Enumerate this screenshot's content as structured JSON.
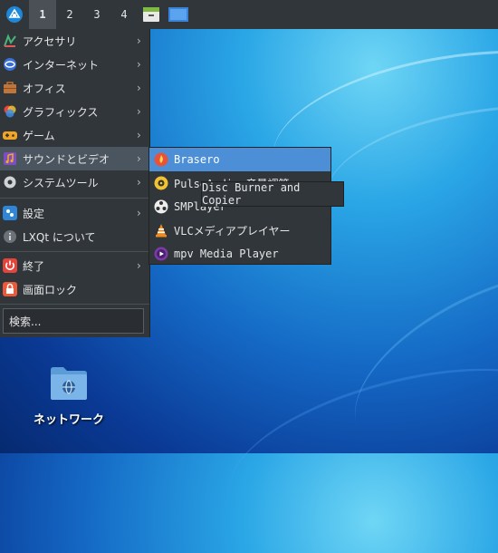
{
  "panel": {
    "desktops": [
      "1",
      "2",
      "3",
      "4"
    ],
    "active_desktop": "1"
  },
  "menu": {
    "items": [
      {
        "label": "アクセサリ",
        "icon": "accessories-icon"
      },
      {
        "label": "インターネット",
        "icon": "internet-icon"
      },
      {
        "label": "オフィス",
        "icon": "office-icon"
      },
      {
        "label": "グラフィックス",
        "icon": "graphics-icon"
      },
      {
        "label": "ゲーム",
        "icon": "games-icon"
      },
      {
        "label": "サウンドとビデオ",
        "icon": "sound-video-icon"
      },
      {
        "label": "システムツール",
        "icon": "system-tools-icon"
      }
    ],
    "settings": "設定",
    "about": "LXQt について",
    "shutdown": "終了",
    "lock": "画面ロック",
    "search_placeholder": "検索..."
  },
  "submenu": {
    "items": [
      {
        "label": "Brasero",
        "icon": "brasero-icon"
      },
      {
        "label": "PulseAudio 音量調節",
        "icon": "pulseaudio-icon"
      },
      {
        "label": "SMPlayer",
        "icon": "smplayer-icon"
      },
      {
        "label": "VLCメディアプレイヤー",
        "icon": "vlc-icon"
      },
      {
        "label": "mpv Media Player",
        "icon": "mpv-icon"
      }
    ]
  },
  "tooltip": "Disc Burner and Copier",
  "desktop_icon": {
    "label": "ネットワーク"
  },
  "colors": {
    "panel": "#31363b",
    "highlight": "#4c8fd6"
  }
}
